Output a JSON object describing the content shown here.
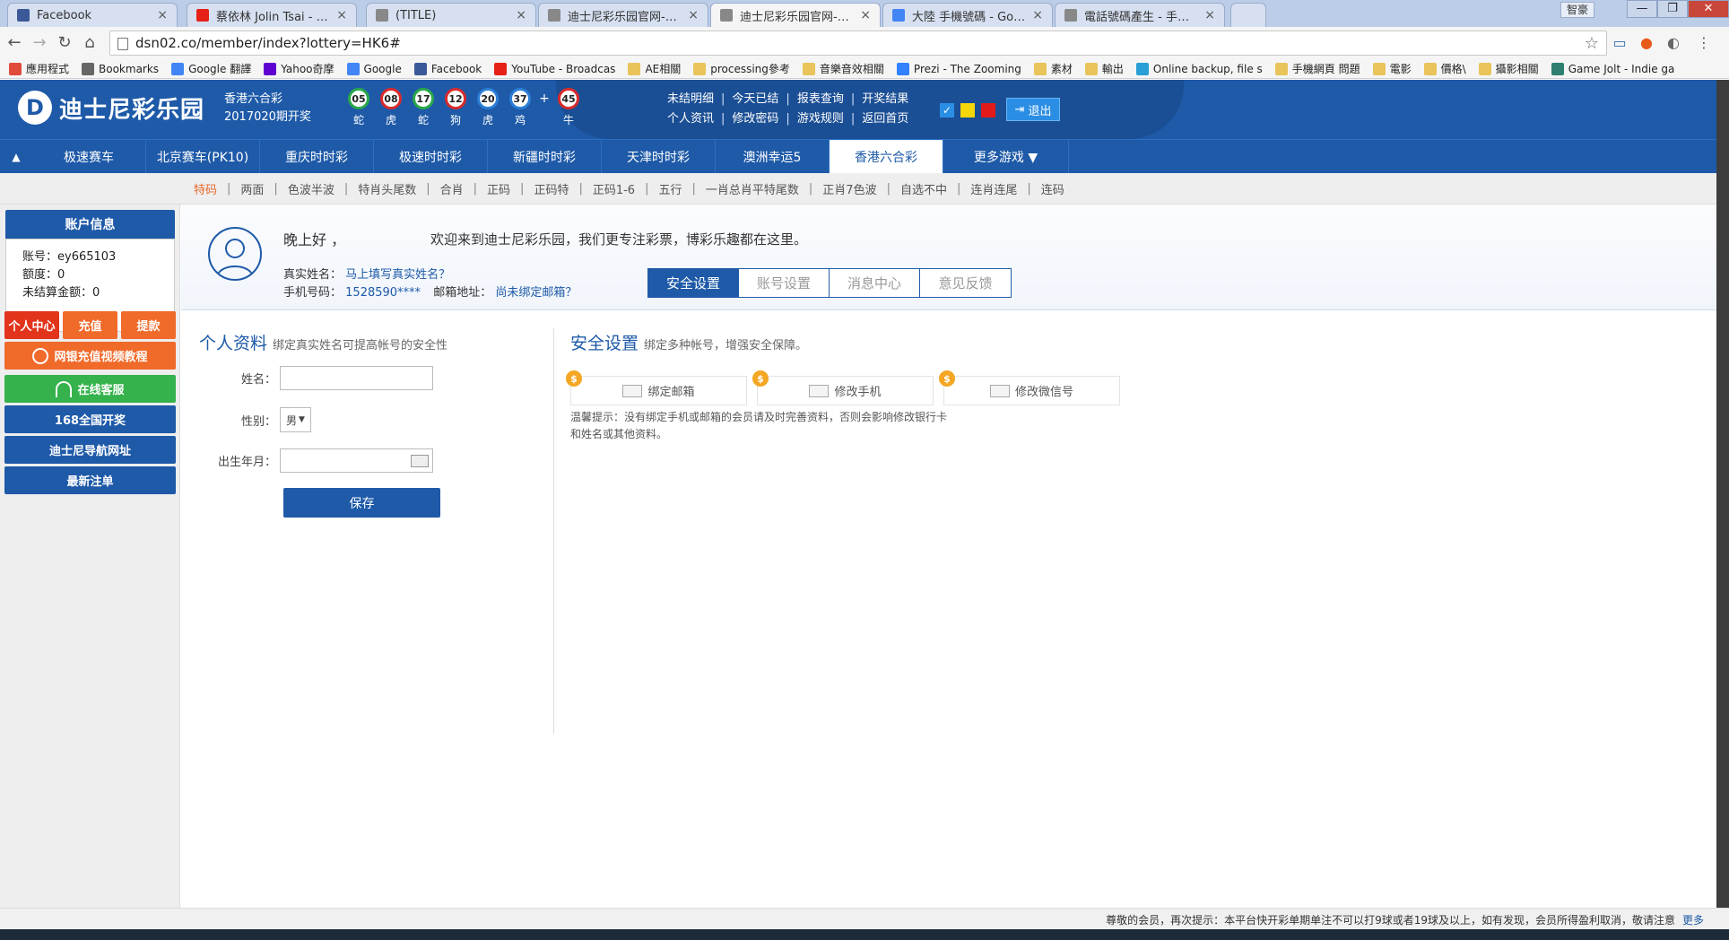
{
  "browser": {
    "tabs": [
      {
        "title": "Facebook",
        "icon_color": "#3b5998",
        "active": false
      },
      {
        "title": "蔡依林 Jolin Tsai - PL",
        "icon_color": "#e62117",
        "active": false
      },
      {
        "title": "(TITLE)",
        "icon_color": "#888888",
        "active": false
      },
      {
        "title": "迪士尼彩乐园官网-专注",
        "icon_color": "#888888",
        "active": false
      },
      {
        "title": "迪士尼彩乐园官网-专注",
        "icon_color": "#888888",
        "active": true
      },
      {
        "title": "大陸 手機號碼 - Google",
        "icon_color": "#4285f4",
        "active": false
      },
      {
        "title": "電話號碼產生 - 手機號碼",
        "icon_color": "#888888",
        "active": false
      }
    ],
    "user_chip": "智豪",
    "url": "dsn02.co/member/index?lottery=HK6#",
    "bookmarks": [
      {
        "label": "應用程式",
        "icon": "apps-icon",
        "color": "#e04a3a"
      },
      {
        "label": "Bookmarks",
        "icon": "star-icon",
        "color": "#666666"
      },
      {
        "label": "Google 翻譯",
        "icon": "translate-icon",
        "color": "#4285f4"
      },
      {
        "label": "Yahoo奇摩",
        "icon": "yahoo-icon",
        "color": "#5f01d1"
      },
      {
        "label": "Google",
        "icon": "google-icon",
        "color": "#4285f4"
      },
      {
        "label": "Facebook",
        "icon": "facebook-icon",
        "color": "#3b5998"
      },
      {
        "label": "YouTube - Broadcas",
        "icon": "youtube-icon",
        "color": "#e62117"
      },
      {
        "label": "AE相關",
        "icon": "folder-icon",
        "color": "#e8c45a"
      },
      {
        "label": "processing參考",
        "icon": "folder-icon",
        "color": "#e8c45a"
      },
      {
        "label": "音樂音效相關",
        "icon": "folder-icon",
        "color": "#e8c45a"
      },
      {
        "label": "Prezi - The Zooming",
        "icon": "prezi-icon",
        "color": "#3181ff"
      },
      {
        "label": "素材",
        "icon": "folder-icon",
        "color": "#e8c45a"
      },
      {
        "label": "輸出",
        "icon": "folder-icon",
        "color": "#e8c45a"
      },
      {
        "label": "Online backup, file s",
        "icon": "backup-icon",
        "color": "#2a9fd6"
      },
      {
        "label": "手機網頁 問題",
        "icon": "folder-icon",
        "color": "#e8c45a"
      },
      {
        "label": "電影",
        "icon": "folder-icon",
        "color": "#e8c45a"
      },
      {
        "label": "價格\\",
        "icon": "folder-icon",
        "color": "#e8c45a"
      },
      {
        "label": "攝影相關",
        "icon": "folder-icon",
        "color": "#e8c45a"
      },
      {
        "label": "Game Jolt - Indie ga",
        "icon": "gamejolt-icon",
        "color": "#2f7f6f"
      }
    ]
  },
  "site": {
    "logo_letter": "D",
    "logo_text": "迪士尼彩乐园",
    "lottery_name": "香港六合彩",
    "period": "2017020期开奖",
    "balls": [
      {
        "num": "05",
        "zodiac": "蛇",
        "color": "green"
      },
      {
        "num": "08",
        "zodiac": "虎",
        "color": "red"
      },
      {
        "num": "17",
        "zodiac": "蛇",
        "color": "green"
      },
      {
        "num": "12",
        "zodiac": "狗",
        "color": "red"
      },
      {
        "num": "20",
        "zodiac": "虎",
        "color": "blue"
      },
      {
        "num": "37",
        "zodiac": "鸡",
        "color": "blue"
      }
    ],
    "special_ball": {
      "num": "45",
      "zodiac": "牛",
      "color": "red"
    },
    "plus": "+",
    "header_links_row1": [
      "未结明细",
      "今天已结",
      "报表查询",
      "开奖结果"
    ],
    "header_links_row2": [
      "个人资讯",
      "修改密码",
      "游戏规则",
      "返回首页"
    ],
    "logout": "退出",
    "theme_colors": [
      "#2b8ee5",
      "#f5d70a",
      "#e21a1a"
    ]
  },
  "game_nav": {
    "toggle": "▲",
    "tabs": [
      "极速赛车",
      "北京赛车(PK10)",
      "重庆时时彩",
      "极速时时彩",
      "新疆时时彩",
      "天津时时彩",
      "澳洲幸运5",
      "香港六合彩"
    ],
    "active_index": 7,
    "more": "更多游戏 ▼"
  },
  "sub_nav": {
    "items": [
      "特码",
      "两面",
      "色波半波",
      "特肖头尾数",
      "合肖",
      "正码",
      "正码特",
      "正码1-6",
      "五行",
      "一肖总肖平特尾数",
      "正肖7色波",
      "自选不中",
      "连肖连尾",
      "连码"
    ],
    "active_index": 0,
    "separator": "|"
  },
  "sidebar": {
    "account_title": "账户信息",
    "account_lines": [
      "账号：ey665103",
      "额度：0",
      "未结算金额：0"
    ],
    "btn_center": "个人中心",
    "btn_deposit": "充值",
    "btn_withdraw": "提款",
    "btn_tutorial": "网银充值视频教程",
    "btn_service": "在线客服",
    "btn_168": "168全国开奖",
    "btn_nav": "迪士尼导航网址",
    "btn_latest": "最新注单"
  },
  "banner": {
    "greeting": "晚上好 ，",
    "welcome": "欢迎来到迪士尼彩乐园，我们更专注彩票，博彩乐趣都在这里。",
    "real_name_label": "真实姓名：",
    "real_name_link": "马上填写真实姓名？",
    "phone_label": "手机号码：",
    "phone_value": "1528590****",
    "email_label": "邮箱地址：",
    "email_link": "尚未绑定邮箱？",
    "tabs": [
      "安全设置",
      "账号设置",
      "消息中心",
      "意见反馈"
    ],
    "active_tab": 0
  },
  "profile": {
    "title": "个人资料",
    "subtitle": "绑定真实姓名可提高帐号的安全性",
    "name_label": "姓名：",
    "gender_label": "性别：",
    "gender_value": "男",
    "birth_label": "出生年月：",
    "save": "保存"
  },
  "security": {
    "title": "安全设置",
    "subtitle": "绑定多种帐号，增强安全保障。",
    "coin_symbol": "$",
    "cards": [
      "绑定邮箱",
      "修改手机",
      "修改微信号"
    ],
    "tip": "温馨提示：没有绑定手机或邮箱的会员请及时完善资料，否则会影响修改银行卡和姓名或其他资料。"
  },
  "footer": {
    "notice": "尊敬的会员，再次提示：本平台快开彩单期单注不可以打9球或者19球及以上，如有发现，会员所得盈利取消，敬请注意",
    "more": "更多"
  }
}
